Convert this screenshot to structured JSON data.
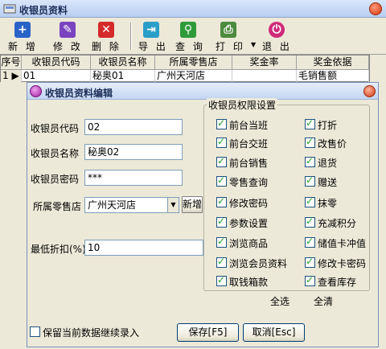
{
  "window": {
    "title": "收银员资料"
  },
  "toolbar": {
    "new": "新 增",
    "edit": "修 改",
    "delete": "删 除",
    "export": "导 出",
    "query": "查 询",
    "print": "打 印",
    "exit": "退 出"
  },
  "grid": {
    "headers": [
      "序号",
      "收银员代码",
      "收银员名称",
      "所属零售店",
      "奖金率",
      "奖金依据"
    ],
    "row": {
      "index": "1",
      "code": "01",
      "name": "秘奥01",
      "store": "广州天河店",
      "rate": "",
      "basis": "毛销售额"
    }
  },
  "dialog": {
    "title": "收银员资料编辑",
    "code_label": "收银员代码",
    "code_value": "02",
    "name_label": "收银员名称",
    "name_value": "秘奥02",
    "password_label": "收银员密码",
    "password_value": "***",
    "store_label": "所属零售店",
    "store_value": "广州天河店",
    "store_new": "新增",
    "discount_label": "最低折扣(%)",
    "discount_value": "10",
    "perm_title": "收银员权限设置",
    "permissions": [
      {
        "label": "前台当班",
        "checked": true
      },
      {
        "label": "打折",
        "checked": true
      },
      {
        "label": "前台交班",
        "checked": true
      },
      {
        "label": "改售价",
        "checked": true
      },
      {
        "label": "前台销售",
        "checked": true
      },
      {
        "label": "退货",
        "checked": true
      },
      {
        "label": "零售查询",
        "checked": true
      },
      {
        "label": "赠送",
        "checked": true
      },
      {
        "label": "修改密码",
        "checked": true
      },
      {
        "label": "抹零",
        "checked": true
      },
      {
        "label": "参数设置",
        "checked": true
      },
      {
        "label": "充减积分",
        "checked": true
      },
      {
        "label": "浏览商品",
        "checked": true
      },
      {
        "label": "储值卡冲值",
        "checked": true
      },
      {
        "label": "浏览会员资料",
        "checked": true
      },
      {
        "label": "修改卡密码",
        "checked": true
      },
      {
        "label": "取钱箱款",
        "checked": true
      },
      {
        "label": "查看库存",
        "checked": true
      }
    ],
    "select_all": "全选",
    "clear_all": "全清",
    "keep_label": "保留当前数据继续录入",
    "save": "保存[F5]",
    "cancel": "取消[Esc]"
  },
  "colors": {
    "title_bg": "#c4d5f2",
    "face": "#ece9d8",
    "check": "#21a121"
  }
}
